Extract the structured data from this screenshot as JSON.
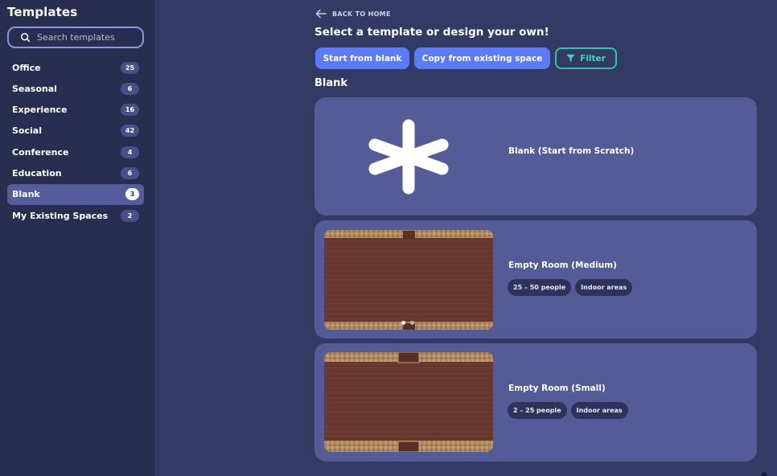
{
  "sidebar": {
    "title": "Templates",
    "search_placeholder": "Search templates",
    "categories": [
      {
        "label": "Office",
        "count": "25"
      },
      {
        "label": "Seasonal",
        "count": "6"
      },
      {
        "label": "Experience",
        "count": "16"
      },
      {
        "label": "Social",
        "count": "42"
      },
      {
        "label": "Conference",
        "count": "4"
      },
      {
        "label": "Education",
        "count": "6"
      },
      {
        "label": "Blank",
        "count": "3",
        "active": true
      },
      {
        "label": "My Existing Spaces",
        "count": "2"
      }
    ]
  },
  "main": {
    "back_label": "BACK TO HOME",
    "title": "Select a template or design your own!",
    "buttons": {
      "start_blank": "Start from blank",
      "copy_existing": "Copy from existing space",
      "filter": "Filter"
    },
    "section_title": "Blank",
    "templates": [
      {
        "name": "Blank (Start from Scratch)",
        "icon": "asterisk-icon"
      },
      {
        "name": "Empty Room (Medium)",
        "tags": [
          "25 – 50 people",
          "Indoor areas"
        ]
      },
      {
        "name": "Empty Room (Small)",
        "tags": [
          "2 – 25 people",
          "Indoor areas"
        ]
      }
    ]
  },
  "colors": {
    "background": "#333a64",
    "sidebar": "#292d4f",
    "card": "#545c98",
    "primary_button": "#5b7cf8",
    "filter_accent": "#2fc4a9",
    "floor": "#6a3a31"
  }
}
